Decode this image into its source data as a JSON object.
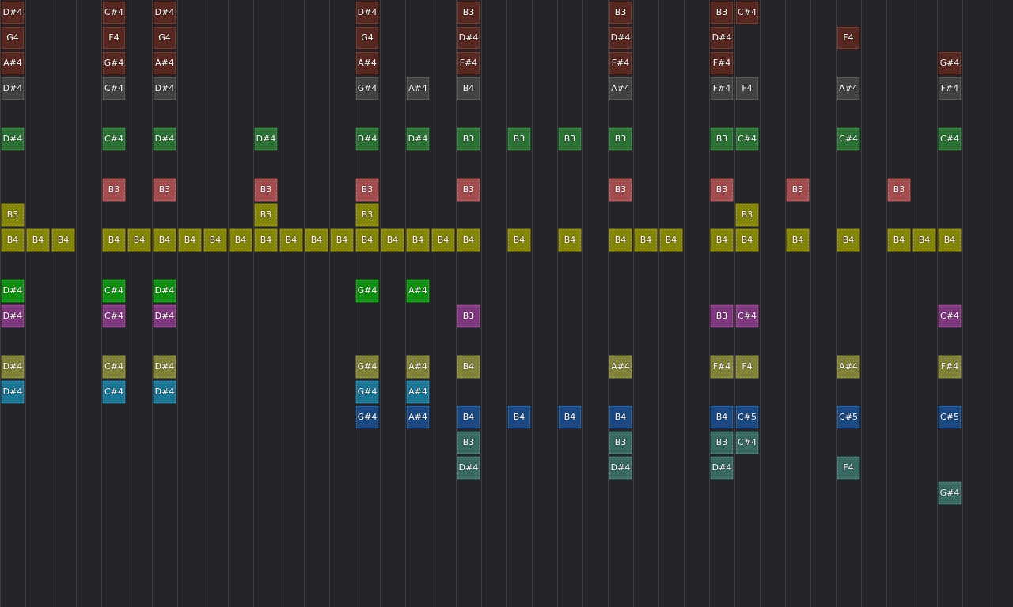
{
  "colors": {
    "maroon": "#5e2a22",
    "gray": "#48484a",
    "green": "#2f7a3a",
    "salmon": "#b05556",
    "olive": "#8f8f0c",
    "bright_green": "#139a13",
    "purple": "#8a3c88",
    "khaki": "#8c8c3e",
    "cyan": "#1e7fa3",
    "blue": "#1d4e8c",
    "teal": "#3d726c"
  },
  "columns": [
    {
      "notes": [
        {
          "row": 0,
          "label": "D#4",
          "color": "maroon"
        },
        {
          "row": 1,
          "label": "G4",
          "color": "maroon"
        },
        {
          "row": 2,
          "label": "A#4",
          "color": "maroon"
        },
        {
          "row": 3,
          "label": "D#4",
          "color": "gray"
        },
        {
          "row": 5,
          "label": "D#4",
          "color": "green"
        },
        {
          "row": 8,
          "label": "B3",
          "color": "olive"
        },
        {
          "row": 9,
          "label": "B4",
          "color": "olive"
        },
        {
          "row": 11,
          "label": "D#4",
          "color": "bright_green"
        },
        {
          "row": 12,
          "label": "D#4",
          "color": "purple"
        },
        {
          "row": 14,
          "label": "D#4",
          "color": "khaki"
        },
        {
          "row": 15,
          "label": "D#4",
          "color": "cyan"
        }
      ]
    },
    {
      "notes": [
        {
          "row": 9,
          "label": "B4",
          "color": "olive"
        }
      ]
    },
    {
      "notes": [
        {
          "row": 9,
          "label": "B4",
          "color": "olive"
        }
      ]
    },
    {
      "notes": []
    },
    {
      "notes": [
        {
          "row": 0,
          "label": "C#4",
          "color": "maroon"
        },
        {
          "row": 1,
          "label": "F4",
          "color": "maroon"
        },
        {
          "row": 2,
          "label": "G#4",
          "color": "maroon"
        },
        {
          "row": 3,
          "label": "C#4",
          "color": "gray"
        },
        {
          "row": 5,
          "label": "C#4",
          "color": "green"
        },
        {
          "row": 7,
          "label": "B3",
          "color": "salmon"
        },
        {
          "row": 9,
          "label": "B4",
          "color": "olive"
        },
        {
          "row": 11,
          "label": "C#4",
          "color": "bright_green"
        },
        {
          "row": 12,
          "label": "C#4",
          "color": "purple"
        },
        {
          "row": 14,
          "label": "C#4",
          "color": "khaki"
        },
        {
          "row": 15,
          "label": "C#4",
          "color": "cyan"
        }
      ]
    },
    {
      "notes": [
        {
          "row": 9,
          "label": "B4",
          "color": "olive"
        }
      ]
    },
    {
      "notes": [
        {
          "row": 0,
          "label": "D#4",
          "color": "maroon"
        },
        {
          "row": 1,
          "label": "G4",
          "color": "maroon"
        },
        {
          "row": 2,
          "label": "A#4",
          "color": "maroon"
        },
        {
          "row": 3,
          "label": "D#4",
          "color": "gray"
        },
        {
          "row": 5,
          "label": "D#4",
          "color": "green"
        },
        {
          "row": 7,
          "label": "B3",
          "color": "salmon"
        },
        {
          "row": 9,
          "label": "B4",
          "color": "olive"
        },
        {
          "row": 11,
          "label": "D#4",
          "color": "bright_green"
        },
        {
          "row": 12,
          "label": "D#4",
          "color": "purple"
        },
        {
          "row": 14,
          "label": "D#4",
          "color": "khaki"
        },
        {
          "row": 15,
          "label": "D#4",
          "color": "cyan"
        }
      ]
    },
    {
      "notes": [
        {
          "row": 9,
          "label": "B4",
          "color": "olive"
        }
      ]
    },
    {
      "notes": [
        {
          "row": 9,
          "label": "B4",
          "color": "olive"
        }
      ]
    },
    {
      "notes": [
        {
          "row": 9,
          "label": "B4",
          "color": "olive"
        }
      ]
    },
    {
      "notes": [
        {
          "row": 5,
          "label": "D#4",
          "color": "green"
        },
        {
          "row": 7,
          "label": "B3",
          "color": "salmon"
        },
        {
          "row": 8,
          "label": "B3",
          "color": "olive"
        },
        {
          "row": 9,
          "label": "B4",
          "color": "olive"
        }
      ]
    },
    {
      "notes": [
        {
          "row": 9,
          "label": "B4",
          "color": "olive"
        }
      ]
    },
    {
      "notes": [
        {
          "row": 9,
          "label": "B4",
          "color": "olive"
        }
      ]
    },
    {
      "notes": [
        {
          "row": 9,
          "label": "B4",
          "color": "olive"
        }
      ]
    },
    {
      "notes": [
        {
          "row": 0,
          "label": "D#4",
          "color": "maroon"
        },
        {
          "row": 1,
          "label": "G4",
          "color": "maroon"
        },
        {
          "row": 2,
          "label": "A#4",
          "color": "maroon"
        },
        {
          "row": 3,
          "label": "G#4",
          "color": "gray"
        },
        {
          "row": 5,
          "label": "D#4",
          "color": "green"
        },
        {
          "row": 7,
          "label": "B3",
          "color": "salmon"
        },
        {
          "row": 8,
          "label": "B3",
          "color": "olive"
        },
        {
          "row": 9,
          "label": "B4",
          "color": "olive"
        },
        {
          "row": 11,
          "label": "G#4",
          "color": "bright_green"
        },
        {
          "row": 14,
          "label": "G#4",
          "color": "khaki"
        },
        {
          "row": 15,
          "label": "G#4",
          "color": "cyan"
        },
        {
          "row": 16,
          "label": "G#4",
          "color": "blue"
        }
      ]
    },
    {
      "notes": [
        {
          "row": 9,
          "label": "B4",
          "color": "olive"
        }
      ]
    },
    {
      "notes": [
        {
          "row": 3,
          "label": "A#4",
          "color": "gray"
        },
        {
          "row": 5,
          "label": "D#4",
          "color": "green"
        },
        {
          "row": 9,
          "label": "B4",
          "color": "olive"
        },
        {
          "row": 11,
          "label": "A#4",
          "color": "bright_green"
        },
        {
          "row": 14,
          "label": "A#4",
          "color": "khaki"
        },
        {
          "row": 15,
          "label": "A#4",
          "color": "cyan"
        },
        {
          "row": 16,
          "label": "A#4",
          "color": "blue"
        }
      ]
    },
    {
      "notes": [
        {
          "row": 9,
          "label": "B4",
          "color": "olive"
        }
      ]
    },
    {
      "notes": [
        {
          "row": 0,
          "label": "B3",
          "color": "maroon"
        },
        {
          "row": 1,
          "label": "D#4",
          "color": "maroon"
        },
        {
          "row": 2,
          "label": "F#4",
          "color": "maroon"
        },
        {
          "row": 3,
          "label": "B4",
          "color": "gray"
        },
        {
          "row": 5,
          "label": "B3",
          "color": "green"
        },
        {
          "row": 7,
          "label": "B3",
          "color": "salmon"
        },
        {
          "row": 9,
          "label": "B4",
          "color": "olive"
        },
        {
          "row": 12,
          "label": "B3",
          "color": "purple"
        },
        {
          "row": 14,
          "label": "B4",
          "color": "khaki"
        },
        {
          "row": 16,
          "label": "B4",
          "color": "blue"
        },
        {
          "row": 17,
          "label": "B3",
          "color": "teal"
        },
        {
          "row": 18,
          "label": "D#4",
          "color": "teal"
        }
      ]
    },
    {
      "notes": []
    },
    {
      "notes": [
        {
          "row": 5,
          "label": "B3",
          "color": "green"
        },
        {
          "row": 9,
          "label": "B4",
          "color": "olive"
        },
        {
          "row": 16,
          "label": "B4",
          "color": "blue"
        }
      ]
    },
    {
      "notes": []
    },
    {
      "notes": [
        {
          "row": 5,
          "label": "B3",
          "color": "green"
        },
        {
          "row": 9,
          "label": "B4",
          "color": "olive"
        },
        {
          "row": 16,
          "label": "B4",
          "color": "blue"
        }
      ]
    },
    {
      "notes": []
    },
    {
      "notes": [
        {
          "row": 0,
          "label": "B3",
          "color": "maroon"
        },
        {
          "row": 1,
          "label": "D#4",
          "color": "maroon"
        },
        {
          "row": 2,
          "label": "F#4",
          "color": "maroon"
        },
        {
          "row": 3,
          "label": "A#4",
          "color": "gray"
        },
        {
          "row": 5,
          "label": "B3",
          "color": "green"
        },
        {
          "row": 7,
          "label": "B3",
          "color": "salmon"
        },
        {
          "row": 9,
          "label": "B4",
          "color": "olive"
        },
        {
          "row": 14,
          "label": "A#4",
          "color": "khaki"
        },
        {
          "row": 16,
          "label": "B4",
          "color": "blue"
        },
        {
          "row": 17,
          "label": "B3",
          "color": "teal"
        },
        {
          "row": 18,
          "label": "D#4",
          "color": "teal"
        }
      ]
    },
    {
      "notes": [
        {
          "row": 9,
          "label": "B4",
          "color": "olive"
        }
      ]
    },
    {
      "notes": [
        {
          "row": 9,
          "label": "B4",
          "color": "olive"
        }
      ]
    },
    {
      "notes": []
    },
    {
      "notes": [
        {
          "row": 0,
          "label": "B3",
          "color": "maroon"
        },
        {
          "row": 1,
          "label": "D#4",
          "color": "maroon"
        },
        {
          "row": 2,
          "label": "F#4",
          "color": "maroon"
        },
        {
          "row": 3,
          "label": "F#4",
          "color": "gray"
        },
        {
          "row": 5,
          "label": "B3",
          "color": "green"
        },
        {
          "row": 7,
          "label": "B3",
          "color": "salmon"
        },
        {
          "row": 9,
          "label": "B4",
          "color": "olive"
        },
        {
          "row": 12,
          "label": "B3",
          "color": "purple"
        },
        {
          "row": 14,
          "label": "F#4",
          "color": "khaki"
        },
        {
          "row": 16,
          "label": "B4",
          "color": "blue"
        },
        {
          "row": 17,
          "label": "B3",
          "color": "teal"
        },
        {
          "row": 18,
          "label": "D#4",
          "color": "teal"
        }
      ]
    },
    {
      "notes": [
        {
          "row": 0,
          "label": "C#4",
          "color": "maroon"
        },
        {
          "row": 3,
          "label": "F4",
          "color": "gray"
        },
        {
          "row": 5,
          "label": "C#4",
          "color": "green"
        },
        {
          "row": 8,
          "label": "B3",
          "color": "olive"
        },
        {
          "row": 9,
          "label": "B4",
          "color": "olive"
        },
        {
          "row": 12,
          "label": "C#4",
          "color": "purple"
        },
        {
          "row": 14,
          "label": "F4",
          "color": "khaki"
        },
        {
          "row": 16,
          "label": "C#5",
          "color": "blue"
        },
        {
          "row": 17,
          "label": "C#4",
          "color": "teal"
        }
      ]
    },
    {
      "notes": []
    },
    {
      "notes": [
        {
          "row": 7,
          "label": "B3",
          "color": "salmon"
        },
        {
          "row": 9,
          "label": "B4",
          "color": "olive"
        }
      ]
    },
    {
      "notes": []
    },
    {
      "notes": [
        {
          "row": 1,
          "label": "F4",
          "color": "maroon"
        },
        {
          "row": 3,
          "label": "A#4",
          "color": "gray"
        },
        {
          "row": 5,
          "label": "C#4",
          "color": "green"
        },
        {
          "row": 9,
          "label": "B4",
          "color": "olive"
        },
        {
          "row": 14,
          "label": "A#4",
          "color": "khaki"
        },
        {
          "row": 16,
          "label": "C#5",
          "color": "blue"
        },
        {
          "row": 18,
          "label": "F4",
          "color": "teal"
        }
      ]
    },
    {
      "notes": []
    },
    {
      "notes": [
        {
          "row": 7,
          "label": "B3",
          "color": "salmon"
        },
        {
          "row": 9,
          "label": "B4",
          "color": "olive"
        }
      ]
    },
    {
      "notes": [
        {
          "row": 9,
          "label": "B4",
          "color": "olive"
        }
      ]
    },
    {
      "notes": [
        {
          "row": 2,
          "label": "G#4",
          "color": "maroon"
        },
        {
          "row": 3,
          "label": "F#4",
          "color": "gray"
        },
        {
          "row": 5,
          "label": "C#4",
          "color": "green"
        },
        {
          "row": 9,
          "label": "B4",
          "color": "olive"
        },
        {
          "row": 12,
          "label": "C#4",
          "color": "purple"
        },
        {
          "row": 14,
          "label": "F#4",
          "color": "khaki"
        },
        {
          "row": 16,
          "label": "C#5",
          "color": "blue"
        },
        {
          "row": 19,
          "label": "G#4",
          "color": "teal"
        }
      ]
    },
    {
      "notes": []
    }
  ]
}
